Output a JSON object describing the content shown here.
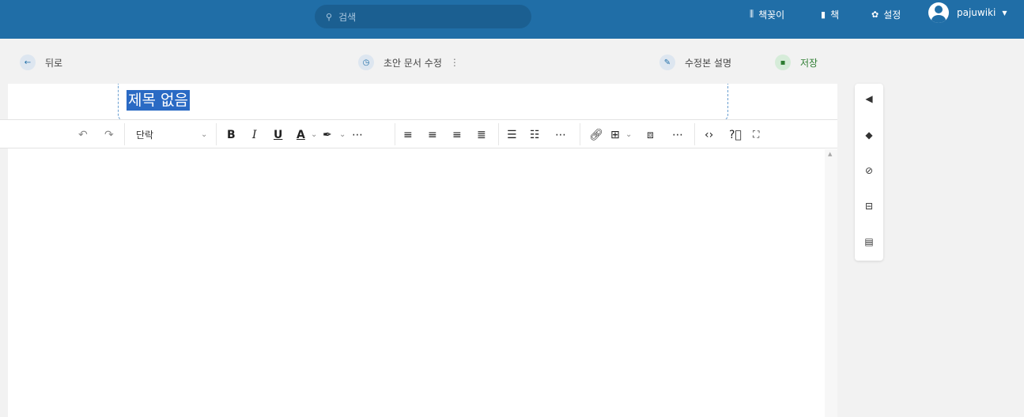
{
  "header": {
    "search_placeholder": "검색",
    "nav": [
      {
        "icon": "shelves-icon",
        "glyph": "⫼",
        "label": "책꽂이"
      },
      {
        "icon": "book-icon",
        "glyph": "■",
        "label": "책"
      },
      {
        "icon": "gear-icon",
        "glyph": "✿",
        "label": "설정"
      }
    ],
    "user_name": "pajuwiki"
  },
  "actions": {
    "back": "뒤로",
    "draft": "초안 문서 수정",
    "changelog": "수정본 설명",
    "save": "저장"
  },
  "title": "제목 없음",
  "toolbar": {
    "block_format": "단락"
  },
  "colors": {
    "header_bg": "#206ea7",
    "save_green": "#2e7d32"
  }
}
